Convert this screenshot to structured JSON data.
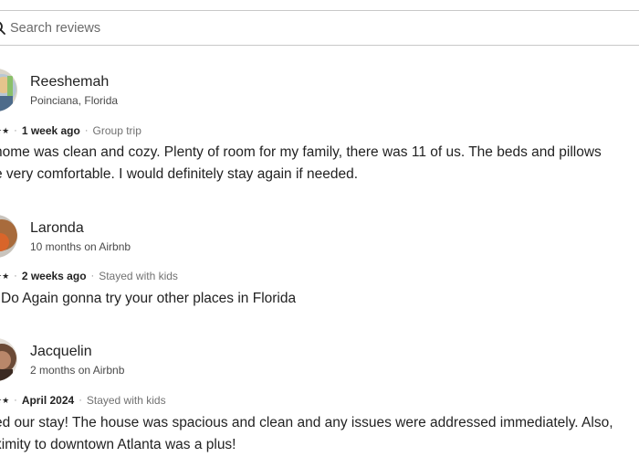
{
  "search": {
    "placeholder": "Search reviews"
  },
  "reviews": [
    {
      "name": "Reeshemah",
      "subtitle": "Poinciana, Florida",
      "stars": "★★",
      "when": "1 week ago",
      "trip": "Group trip",
      "text_lines": [
        " home was clean and cozy. Plenty of room for my family, there was 11 of us. The beds and pillows",
        "e very comfortable. I would definitely stay again if needed."
      ]
    },
    {
      "name": "Laronda",
      "subtitle": "10 months on Airbnb",
      "stars": "★★",
      "when": "2 weeks ago",
      "trip": "Stayed with kids",
      "text_lines": [
        "Do Again gonna try your other places in Florida"
      ]
    },
    {
      "name": "Jacquelin",
      "subtitle": "2 months on Airbnb",
      "stars": "★★",
      "when": "April 2024",
      "trip": "Stayed with kids",
      "text_lines": [
        "ed our stay! The house was spacious and clean and any issues were addressed immediately. Also,",
        "ximity to downtown Atlanta was a plus!"
      ]
    }
  ],
  "colors": {
    "text": "#222222",
    "muted": "#717171",
    "border": "#c8c8c8"
  }
}
